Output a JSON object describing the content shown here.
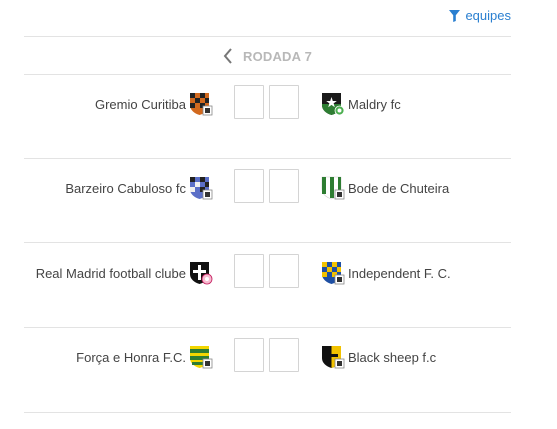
{
  "filter": {
    "label": "equipes",
    "icon": "filter-icon",
    "color": "#2a7fd0"
  },
  "round": {
    "label": "RODADA 7",
    "prev_icon": "chevron-left-icon"
  },
  "matches": [
    {
      "home": {
        "name": "Gremio Curitiba",
        "shield": "shield-orange-checker"
      },
      "away": {
        "name": "Maldry fc",
        "shield": "shield-black-green-star"
      },
      "home_score": "",
      "away_score": ""
    },
    {
      "home": {
        "name": "Barzeiro Cabuloso fc",
        "shield": "shield-blue-checker"
      },
      "away": {
        "name": "Bode de Chuteira",
        "shield": "shield-green-stripes"
      },
      "home_score": "",
      "away_score": ""
    },
    {
      "home": {
        "name": "Real Madrid football clube",
        "shield": "shield-black-white-cross"
      },
      "away": {
        "name": "Independent F. C.",
        "shield": "shield-blue-yellow-checker"
      },
      "home_score": "",
      "away_score": ""
    },
    {
      "home": {
        "name": "Força e Honra F.C.",
        "shield": "shield-green-yellow-stripes"
      },
      "away": {
        "name": "Black sheep f.c",
        "shield": "shield-black-yellow-half"
      },
      "home_score": "",
      "away_score": ""
    }
  ]
}
